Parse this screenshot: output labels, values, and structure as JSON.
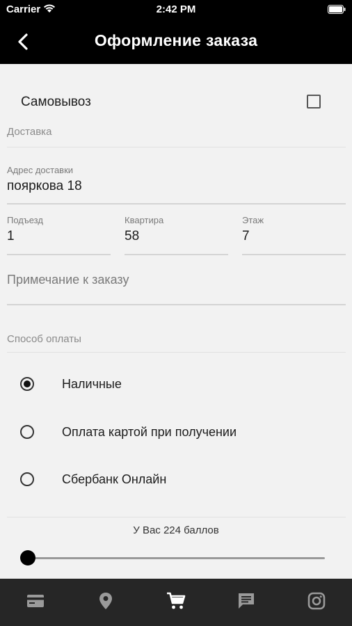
{
  "status_bar": {
    "carrier": "Carrier",
    "time": "2:42 PM"
  },
  "nav": {
    "title": "Оформление заказа",
    "back_icon": "chevron-left-icon"
  },
  "pickup": {
    "label": "Самовывоз",
    "checked": false
  },
  "delivery": {
    "section_title": "Доставка",
    "address": {
      "label": "Адрес доставки",
      "value": "пояркова 18"
    },
    "entrance": {
      "label": "Подъезд",
      "value": "1"
    },
    "apartment": {
      "label": "Квартира",
      "value": "58"
    },
    "floor": {
      "label": "Этаж",
      "value": "7"
    },
    "note": {
      "placeholder": "Примечание к заказу"
    }
  },
  "payment": {
    "section_title": "Способ оплаты",
    "options": [
      {
        "label": "Наличные",
        "selected": true
      },
      {
        "label": "Оплата картой при получении",
        "selected": false
      },
      {
        "label": "Сбербанк Онлайн",
        "selected": false
      }
    ]
  },
  "bonus": {
    "text": "У Вас 224 баллов",
    "slider_fraction": 0
  },
  "tabbar": {
    "items": [
      {
        "icon": "credit-card-icon"
      },
      {
        "icon": "location-pin-icon"
      },
      {
        "icon": "cart-icon",
        "active": true
      },
      {
        "icon": "chat-icon"
      },
      {
        "icon": "instagram-icon"
      }
    ]
  },
  "colors": {
    "bar_bg": "#000000",
    "tabbar_bg": "#262626",
    "page_bg": "#f2f2f2",
    "active_tab": "#ffffff",
    "inactive_tab": "#9a9a9a"
  }
}
